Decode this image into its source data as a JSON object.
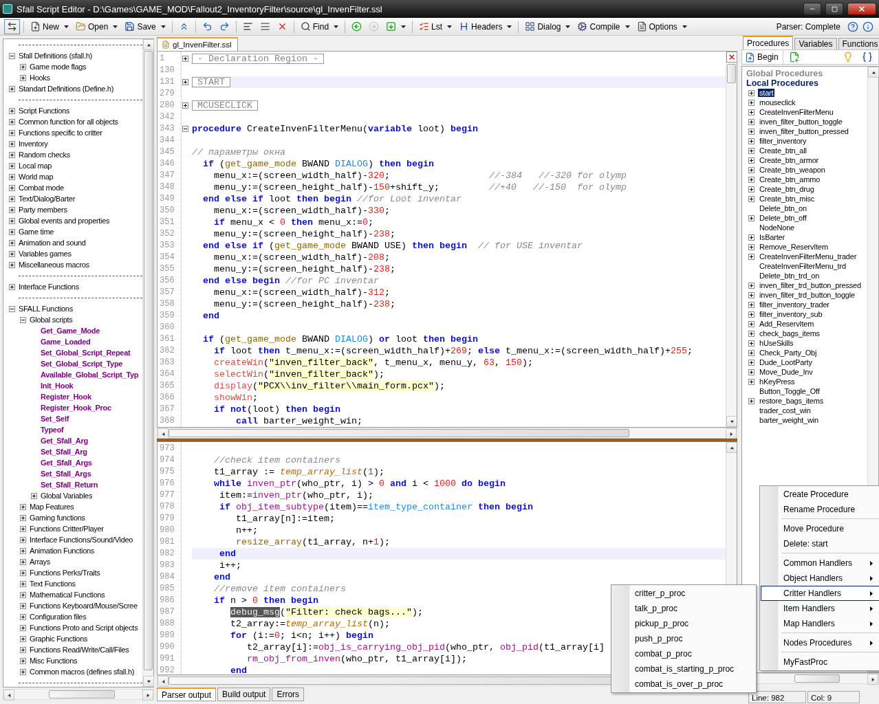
{
  "window": {
    "title": "Sfall Script Editor - D:\\Games\\GAME_MOD\\Fallout2_InventoryFilter\\source\\gl_InvenFilter.ssl"
  },
  "toolbar": {
    "items": [
      {
        "kind": "button",
        "dropdown": false,
        "disabled": false
      },
      {
        "kind": "separator"
      },
      {
        "kind": "button",
        "label": "New",
        "dropdown": true,
        "disabled": false
      },
      {
        "kind": "button",
        "label": "Open",
        "dropdown": true,
        "disabled": false
      },
      {
        "kind": "button",
        "label": "Save",
        "dropdown": true,
        "disabled": false
      },
      {
        "kind": "separator"
      },
      {
        "kind": "button",
        "dropdown": false,
        "disabled": false
      },
      {
        "kind": "separator"
      },
      {
        "kind": "button",
        "dropdown": false,
        "disabled": false
      },
      {
        "kind": "button",
        "dropdown": false,
        "disabled": false
      },
      {
        "kind": "separator"
      },
      {
        "kind": "button",
        "dropdown": false,
        "disabled": false
      },
      {
        "kind": "button",
        "dropdown": false,
        "disabled": false
      },
      {
        "kind": "button",
        "dropdown": false,
        "disabled": false
      },
      {
        "kind": "separator"
      },
      {
        "kind": "button",
        "label": "Find",
        "dropdown": true,
        "disabled": false
      },
      {
        "kind": "separator"
      },
      {
        "kind": "button",
        "dropdown": false,
        "disabled": false
      },
      {
        "kind": "button",
        "dropdown": false,
        "disabled": true
      },
      {
        "kind": "button",
        "dropdown": true,
        "disabled": false
      },
      {
        "kind": "separator"
      },
      {
        "kind": "button",
        "label": "Lst",
        "dropdown": true,
        "disabled": false
      },
      {
        "kind": "button",
        "label": "Headers",
        "dropdown": true,
        "disabled": false
      },
      {
        "kind": "separator"
      },
      {
        "kind": "button",
        "label": "Dialog",
        "dropdown": true,
        "disabled": false
      },
      {
        "kind": "button",
        "label": "Compile",
        "dropdown": true,
        "disabled": false
      },
      {
        "kind": "button",
        "label": "Options",
        "dropdown": true,
        "disabled": false
      }
    ],
    "status": "Parser: Complete"
  },
  "left_tree": {
    "nodes": [
      {
        "kind": "separator"
      },
      {
        "kind": "folder",
        "label": "Sfall Definitions (sfall.h)",
        "expanded": true,
        "children": [
          {
            "kind": "folder",
            "label": "Game mode flags",
            "expanded": false
          },
          {
            "kind": "folder",
            "label": "Hooks",
            "expanded": false
          }
        ]
      },
      {
        "kind": "folder",
        "label": "Standart Definitions (Define.h)",
        "expanded": false
      },
      {
        "kind": "separator"
      },
      {
        "kind": "folder",
        "label": "Script Functions",
        "expanded": false
      },
      {
        "kind": "folder",
        "label": "Common function for all objects",
        "expanded": false
      },
      {
        "kind": "folder",
        "label": "Functions specific to critter",
        "expanded": false
      },
      {
        "kind": "folder",
        "label": "Inventory",
        "expanded": false
      },
      {
        "kind": "folder",
        "label": "Random checks",
        "expanded": false
      },
      {
        "kind": "folder",
        "label": "Local map",
        "expanded": false
      },
      {
        "kind": "folder",
        "label": "World map",
        "expanded": false
      },
      {
        "kind": "folder",
        "label": "Combat mode",
        "expanded": false
      },
      {
        "kind": "folder",
        "label": "Text/Dialog/Barter",
        "expanded": false
      },
      {
        "kind": "folder",
        "label": "Party members",
        "expanded": false
      },
      {
        "kind": "folder",
        "label": "Global events and properties",
        "expanded": false
      },
      {
        "kind": "folder",
        "label": "Game time",
        "expanded": false
      },
      {
        "kind": "folder",
        "label": "Animation and sound",
        "expanded": false
      },
      {
        "kind": "folder",
        "label": "Variables games",
        "expanded": false
      },
      {
        "kind": "folder",
        "label": "Miscellaneous macros",
        "expanded": false
      },
      {
        "kind": "separator"
      },
      {
        "kind": "folder",
        "label": "Interface Functions",
        "expanded": false
      },
      {
        "kind": "separator"
      },
      {
        "kind": "folder",
        "label": "SFALL Functions",
        "expanded": true,
        "children": [
          {
            "kind": "folder",
            "label": "Global scripts",
            "expanded": true,
            "children": [
              {
                "kind": "function",
                "label": "Get_Game_Mode"
              },
              {
                "kind": "function",
                "label": "Game_Loaded"
              },
              {
                "kind": "function",
                "label": "Set_Global_Script_Repeat"
              },
              {
                "kind": "function",
                "label": "Set_Global_Script_Type"
              },
              {
                "kind": "function",
                "label": "Available_Global_Script_Typ"
              },
              {
                "kind": "function",
                "label": "Init_Hook"
              },
              {
                "kind": "function",
                "label": "Register_Hook"
              },
              {
                "kind": "function",
                "label": "Register_Hook_Proc"
              },
              {
                "kind": "function",
                "label": "Set_Self"
              },
              {
                "kind": "function",
                "label": "Typeof"
              },
              {
                "kind": "function",
                "label": "Get_Sfall_Arg"
              },
              {
                "kind": "function",
                "label": "Set_Sfall_Arg"
              },
              {
                "kind": "function",
                "label": "Get_Sfall_Args"
              },
              {
                "kind": "function",
                "label": "Set_Sfall_Args"
              },
              {
                "kind": "function",
                "label": "Set_Sfall_Return"
              },
              {
                "kind": "folder",
                "label": "Global Variables",
                "expanded": false
              }
            ]
          },
          {
            "kind": "folder",
            "label": "Map Features",
            "expanded": false
          },
          {
            "kind": "folder",
            "label": "Gaming functions",
            "expanded": false
          },
          {
            "kind": "folder",
            "label": "Functions Critter/Player",
            "expanded": false
          },
          {
            "kind": "folder",
            "label": "Interface Functions/Sound/Video",
            "expanded": false
          },
          {
            "kind": "folder",
            "label": "Animation Functions",
            "expanded": false
          },
          {
            "kind": "folder",
            "label": "Arrays",
            "expanded": false
          },
          {
            "kind": "folder",
            "label": "Functions Perks/Traits",
            "expanded": false
          },
          {
            "kind": "folder",
            "label": "Text Functions",
            "expanded": false
          },
          {
            "kind": "folder",
            "label": "Mathematical Functions",
            "expanded": false
          },
          {
            "kind": "folder",
            "label": "Functions Keyboard/Mouse/Scree",
            "expanded": false
          },
          {
            "kind": "folder",
            "label": "Configuration files",
            "expanded": false
          },
          {
            "kind": "folder",
            "label": "Functions Proto and Script objects",
            "expanded": false
          },
          {
            "kind": "folder",
            "label": "Graphic Functions",
            "expanded": false
          },
          {
            "kind": "folder",
            "label": "Functions Read/Write/Call/Files",
            "expanded": false
          },
          {
            "kind": "folder",
            "label": "Misc Functions",
            "expanded": false
          },
          {
            "kind": "folder",
            "label": "Common macros (defines sfall.h)",
            "expanded": false
          }
        ]
      },
      {
        "kind": "separator"
      }
    ]
  },
  "file_tab": {
    "label": "gl_InvenFilter.ssl",
    "selected": true
  },
  "top_editor": {
    "lines": [
      {
        "n": "1",
        "kind": "region",
        "label": "- Declaration Region -",
        "expanded": false,
        "current": false
      },
      {
        "n": "130",
        "current": false
      },
      {
        "n": "131",
        "kind": "region",
        "label": "START",
        "expanded": false,
        "current": true
      },
      {
        "n": "279",
        "current": false
      },
      {
        "n": "280",
        "kind": "region",
        "label": "MCUSECLICK",
        "expanded": false,
        "current": false
      },
      {
        "n": "342",
        "current": false
      },
      {
        "n": "343",
        "kind": "code",
        "expanded": true,
        "current": false,
        "tokens": [
          {
            "text": "procedure",
            "kind": "kw"
          },
          {
            "text": " CreateInvenFilterMenu(",
            "kind": "p"
          },
          {
            "text": "variable",
            "kind": "kw"
          },
          {
            "text": " loot) ",
            "kind": "p"
          },
          {
            "text": "begin",
            "kind": "kw"
          }
        ]
      },
      {
        "n": "344",
        "current": false
      },
      {
        "n": "345",
        "kind": "code",
        "current": false,
        "tokens": [
          {
            "text": "// параметры окна",
            "kind": "cmt"
          }
        ]
      },
      {
        "n": "346",
        "kind": "code",
        "current": false,
        "tokens": [
          {
            "text": "  if",
            "kind": "kw"
          },
          {
            "text": " (",
            "kind": "p"
          },
          {
            "text": "get_game_mode",
            "kind": "fn"
          },
          {
            "text": " BWAND ",
            "kind": "p"
          },
          {
            "text": "DIALOG",
            "kind": "const"
          },
          {
            "text": ") ",
            "kind": "p"
          },
          {
            "text": "then begin",
            "kind": "kw"
          }
        ]
      },
      {
        "n": "347",
        "kind": "code",
        "current": false,
        "tokens": [
          {
            "text": "    menu_x:=(screen_width_half)-",
            "kind": "p"
          },
          {
            "text": "320",
            "kind": "num"
          },
          {
            "text": ";                  ",
            "kind": "p"
          },
          {
            "text": "//-384   //-320 for olymp",
            "kind": "cmt"
          }
        ]
      },
      {
        "n": "348",
        "kind": "code",
        "current": false,
        "tokens": [
          {
            "text": "    menu_y:=(screen_height_half)-",
            "kind": "p"
          },
          {
            "text": "150",
            "kind": "num"
          },
          {
            "text": "+shift_y;         ",
            "kind": "p"
          },
          {
            "text": "//+40   //-150  for olymp",
            "kind": "cmt"
          }
        ]
      },
      {
        "n": "349",
        "kind": "code",
        "current": false,
        "tokens": [
          {
            "text": "  end else if",
            "kind": "kw"
          },
          {
            "text": " loot ",
            "kind": "p"
          },
          {
            "text": "then begin",
            "kind": "kw"
          },
          {
            "text": " //for Loot inventar",
            "kind": "cmt"
          }
        ]
      },
      {
        "n": "350",
        "kind": "code",
        "current": false,
        "tokens": [
          {
            "text": "    menu_x:=(screen_width_half)-",
            "kind": "p"
          },
          {
            "text": "330",
            "kind": "num"
          },
          {
            "text": ";",
            "kind": "p"
          }
        ]
      },
      {
        "n": "351",
        "kind": "code",
        "current": false,
        "tokens": [
          {
            "text": "    if",
            "kind": "kw"
          },
          {
            "text": " menu_x < ",
            "kind": "p"
          },
          {
            "text": "0",
            "kind": "num"
          },
          {
            "text": " then",
            "kind": "kw"
          },
          {
            "text": " menu_x:=",
            "kind": "p"
          },
          {
            "text": "0",
            "kind": "num"
          },
          {
            "text": ";",
            "kind": "p"
          }
        ]
      },
      {
        "n": "352",
        "kind": "code",
        "current": false,
        "tokens": [
          {
            "text": "    menu_y:=(screen_height_half)-",
            "kind": "p"
          },
          {
            "text": "238",
            "kind": "num"
          },
          {
            "text": ";",
            "kind": "p"
          }
        ]
      },
      {
        "n": "353",
        "kind": "code",
        "current": false,
        "tokens": [
          {
            "text": "  end else if",
            "kind": "kw"
          },
          {
            "text": " (",
            "kind": "p"
          },
          {
            "text": "get_game_mode",
            "kind": "fn"
          },
          {
            "text": " BWAND USE) ",
            "kind": "p"
          },
          {
            "text": "then begin",
            "kind": "kw"
          },
          {
            "text": "  // for USE inventar",
            "kind": "cmt"
          }
        ]
      },
      {
        "n": "354",
        "kind": "code",
        "current": false,
        "tokens": [
          {
            "text": "    menu_x:=(screen_width_half)-",
            "kind": "p"
          },
          {
            "text": "208",
            "kind": "num"
          },
          {
            "text": ";",
            "kind": "p"
          }
        ]
      },
      {
        "n": "355",
        "kind": "code",
        "current": false,
        "tokens": [
          {
            "text": "    menu_y:=(screen_height_half)-",
            "kind": "p"
          },
          {
            "text": "238",
            "kind": "num"
          },
          {
            "text": ";",
            "kind": "p"
          }
        ]
      },
      {
        "n": "356",
        "kind": "code",
        "current": false,
        "tokens": [
          {
            "text": "  end else begin",
            "kind": "kw"
          },
          {
            "text": " //for PC inventar",
            "kind": "cmt"
          }
        ]
      },
      {
        "n": "357",
        "kind": "code",
        "current": false,
        "tokens": [
          {
            "text": "    menu_x:=(screen_width_half)-",
            "kind": "p"
          },
          {
            "text": "312",
            "kind": "num"
          },
          {
            "text": ";",
            "kind": "p"
          }
        ]
      },
      {
        "n": "358",
        "kind": "code",
        "current": false,
        "tokens": [
          {
            "text": "    menu_y:=(screen_height_half)-",
            "kind": "p"
          },
          {
            "text": "238",
            "kind": "num"
          },
          {
            "text": ";",
            "kind": "p"
          }
        ]
      },
      {
        "n": "359",
        "kind": "code",
        "current": false,
        "tokens": [
          {
            "text": "  end",
            "kind": "kw"
          }
        ]
      },
      {
        "n": "360",
        "current": false
      },
      {
        "n": "361",
        "kind": "code",
        "current": false,
        "tokens": [
          {
            "text": "  if",
            "kind": "kw"
          },
          {
            "text": " (",
            "kind": "p"
          },
          {
            "text": "get_game_mode",
            "kind": "fn"
          },
          {
            "text": " BWAND ",
            "kind": "p"
          },
          {
            "text": "DIALOG",
            "kind": "const"
          },
          {
            "text": ") ",
            "kind": "p"
          },
          {
            "text": "or",
            "kind": "kw"
          },
          {
            "text": " loot ",
            "kind": "p"
          },
          {
            "text": "then begin",
            "kind": "kw"
          }
        ]
      },
      {
        "n": "362",
        "kind": "code",
        "current": false,
        "tokens": [
          {
            "text": "    if",
            "kind": "kw"
          },
          {
            "text": " loot ",
            "kind": "p"
          },
          {
            "text": "then",
            "kind": "kw"
          },
          {
            "text": " t_menu_x:=(screen_width_half)+",
            "kind": "p"
          },
          {
            "text": "269",
            "kind": "num"
          },
          {
            "text": "; ",
            "kind": "p"
          },
          {
            "text": "else",
            "kind": "kw"
          },
          {
            "text": " t_menu_x:=(screen_width_half)+",
            "kind": "p"
          },
          {
            "text": "255",
            "kind": "num"
          },
          {
            "text": ";",
            "kind": "p"
          }
        ]
      },
      {
        "n": "363",
        "kind": "code",
        "current": false,
        "tokens": [
          {
            "text": "    createWin",
            "kind": "lib"
          },
          {
            "text": "(",
            "kind": "p"
          },
          {
            "text": "\"inven_filter_back\"",
            "kind": "str"
          },
          {
            "text": ", t_menu_x, menu_y, ",
            "kind": "p"
          },
          {
            "text": "63",
            "kind": "num"
          },
          {
            "text": ", ",
            "kind": "p"
          },
          {
            "text": "150",
            "kind": "num"
          },
          {
            "text": ");",
            "kind": "p"
          }
        ]
      },
      {
        "n": "364",
        "kind": "code",
        "current": false,
        "tokens": [
          {
            "text": "    selectWin",
            "kind": "lib"
          },
          {
            "text": "(",
            "kind": "p"
          },
          {
            "text": "\"inven_filter_back\"",
            "kind": "str"
          },
          {
            "text": ");",
            "kind": "p"
          }
        ]
      },
      {
        "n": "365",
        "kind": "code",
        "current": false,
        "tokens": [
          {
            "text": "    display",
            "kind": "lib"
          },
          {
            "text": "(",
            "kind": "p"
          },
          {
            "text": "\"PCX\\\\inv_filter\\\\main_form.pcx\"",
            "kind": "str"
          },
          {
            "text": ");",
            "kind": "p"
          }
        ]
      },
      {
        "n": "366",
        "kind": "code",
        "current": false,
        "tokens": [
          {
            "text": "    showWin",
            "kind": "lib"
          },
          {
            "text": ";",
            "kind": "p"
          }
        ]
      },
      {
        "n": "367",
        "kind": "code",
        "current": false,
        "tokens": [
          {
            "text": "    if not",
            "kind": "kw"
          },
          {
            "text": "(loot) ",
            "kind": "p"
          },
          {
            "text": "then begin",
            "kind": "kw"
          }
        ]
      },
      {
        "n": "368",
        "kind": "code",
        "current": false,
        "tokens": [
          {
            "text": "        call",
            "kind": "kw"
          },
          {
            "text": " barter_weight_win;",
            "kind": "p"
          }
        ]
      }
    ]
  },
  "bottom_editor": {
    "lines": [
      {
        "n": "973",
        "current": false
      },
      {
        "n": "974",
        "kind": "code",
        "current": false,
        "tokens": [
          {
            "text": "    //check item containers",
            "kind": "cmt"
          }
        ]
      },
      {
        "n": "975",
        "kind": "code",
        "current": false,
        "tokens": [
          {
            "text": "    t1_array := ",
            "kind": "p"
          },
          {
            "text": "temp_array_list",
            "kind": "tmp"
          },
          {
            "text": "(",
            "kind": "p"
          },
          {
            "text": "1",
            "kind": "num"
          },
          {
            "text": ");",
            "kind": "p"
          }
        ]
      },
      {
        "n": "976",
        "kind": "code",
        "current": false,
        "tokens": [
          {
            "text": "    while",
            "kind": "kw"
          },
          {
            "text": " inven_ptr",
            "kind": "proc"
          },
          {
            "text": "(who_ptr, i) > ",
            "kind": "p"
          },
          {
            "text": "0",
            "kind": "num"
          },
          {
            "text": " and",
            "kind": "kw"
          },
          {
            "text": " i < ",
            "kind": "p"
          },
          {
            "text": "1000",
            "kind": "num"
          },
          {
            "text": " do begin",
            "kind": "kw"
          }
        ]
      },
      {
        "n": "977",
        "kind": "code",
        "current": false,
        "tokens": [
          {
            "text": "     item:=",
            "kind": "p"
          },
          {
            "text": "inven_ptr",
            "kind": "proc"
          },
          {
            "text": "(who_ptr, i);",
            "kind": "p"
          }
        ]
      },
      {
        "n": "978",
        "kind": "code",
        "current": false,
        "tokens": [
          {
            "text": "     if",
            "kind": "kw"
          },
          {
            "text": " obj_item_subtype",
            "kind": "proc"
          },
          {
            "text": "(item)==",
            "kind": "p"
          },
          {
            "text": "item_type_container",
            "kind": "const"
          },
          {
            "text": " then begin",
            "kind": "kw"
          }
        ]
      },
      {
        "n": "979",
        "kind": "code",
        "current": false,
        "tokens": [
          {
            "text": "        t1_array[n]:=item;",
            "kind": "p"
          }
        ]
      },
      {
        "n": "980",
        "kind": "code",
        "current": false,
        "tokens": [
          {
            "text": "        n++;",
            "kind": "p"
          }
        ]
      },
      {
        "n": "981",
        "kind": "code",
        "current": false,
        "tokens": [
          {
            "text": "        resize_array",
            "kind": "fn"
          },
          {
            "text": "(t1_array, n+",
            "kind": "p"
          },
          {
            "text": "1",
            "kind": "num"
          },
          {
            "text": ");",
            "kind": "p"
          }
        ]
      },
      {
        "n": "982",
        "kind": "code",
        "current": true,
        "tokens": [
          {
            "text": "     end",
            "kind": "kw"
          }
        ]
      },
      {
        "n": "983",
        "kind": "code",
        "current": false,
        "tokens": [
          {
            "text": "     i++;",
            "kind": "p"
          }
        ]
      },
      {
        "n": "984",
        "kind": "code",
        "current": false,
        "tokens": [
          {
            "text": "    end",
            "kind": "kw"
          }
        ]
      },
      {
        "n": "985",
        "kind": "code",
        "current": false,
        "tokens": [
          {
            "text": "    //remove item containers",
            "kind": "cmt"
          }
        ]
      },
      {
        "n": "986",
        "kind": "code",
        "current": false,
        "tokens": [
          {
            "text": "    if",
            "kind": "kw"
          },
          {
            "text": " n > ",
            "kind": "p"
          },
          {
            "text": "0",
            "kind": "num"
          },
          {
            "text": " then begin",
            "kind": "kw"
          }
        ]
      },
      {
        "n": "987",
        "kind": "code",
        "current": false,
        "tokens": [
          {
            "text": "       debug_msg",
            "kind": "sel"
          },
          {
            "text": "(",
            "kind": "p"
          },
          {
            "text": "\"Filter: check bags...\"",
            "kind": "str"
          },
          {
            "text": ");",
            "kind": "p"
          }
        ]
      },
      {
        "n": "988",
        "kind": "code",
        "current": false,
        "tokens": [
          {
            "text": "       t2_array:=",
            "kind": "p"
          },
          {
            "text": "temp_array_list",
            "kind": "tmp"
          },
          {
            "text": "(n);",
            "kind": "p"
          }
        ]
      },
      {
        "n": "989",
        "kind": "code",
        "current": false,
        "tokens": [
          {
            "text": "       for",
            "kind": "kw"
          },
          {
            "text": " (i:=",
            "kind": "p"
          },
          {
            "text": "0",
            "kind": "num"
          },
          {
            "text": "; i<n; i++) ",
            "kind": "p"
          },
          {
            "text": "begin",
            "kind": "kw"
          }
        ]
      },
      {
        "n": "990",
        "kind": "code",
        "current": false,
        "tokens": [
          {
            "text": "          t2_array[i]:=",
            "kind": "p"
          },
          {
            "text": "obj_is_carrying_obj_pid",
            "kind": "proc"
          },
          {
            "text": "(who_ptr, ",
            "kind": "p"
          },
          {
            "text": "obj_pid",
            "kind": "proc"
          },
          {
            "text": "(t1_array[i]",
            "kind": "p"
          }
        ]
      },
      {
        "n": "991",
        "kind": "code",
        "current": false,
        "tokens": [
          {
            "text": "          rm_obj_from_inven",
            "kind": "proc"
          },
          {
            "text": "(who_ptr, t1_array[i]);",
            "kind": "p"
          }
        ]
      },
      {
        "n": "992",
        "kind": "code",
        "current": false,
        "tokens": [
          {
            "text": "       end",
            "kind": "kw"
          }
        ]
      }
    ]
  },
  "bottom_tabs": [
    {
      "label": "Parser output",
      "selected": true
    },
    {
      "label": "Build output",
      "selected": false
    },
    {
      "label": "Errors",
      "selected": false
    }
  ],
  "right_panel": {
    "tabs": [
      {
        "label": "Procedures",
        "selected": true
      },
      {
        "label": "Variables",
        "selected": false
      },
      {
        "label": "Functions",
        "selected": false
      }
    ],
    "begin_button": "Begin",
    "headers": [
      {
        "label": "Global Procedures",
        "kind": "global"
      },
      {
        "label": "Local Procedures",
        "kind": "local"
      }
    ],
    "items": [
      {
        "label": "start",
        "expandable": true,
        "selected": true
      },
      {
        "label": "mouseclick",
        "expandable": true,
        "selected": false
      },
      {
        "label": "CreateInvenFilterMenu",
        "expandable": true,
        "selected": false
      },
      {
        "label": "inven_filter_button_toggle",
        "expandable": true,
        "selected": false
      },
      {
        "label": "inven_filter_button_pressed",
        "expandable": true,
        "selected": false
      },
      {
        "label": "filter_inventory",
        "expandable": true,
        "selected": false
      },
      {
        "label": "Create_btn_all",
        "expandable": true,
        "selected": false
      },
      {
        "label": "Create_btn_armor",
        "expandable": true,
        "selected": false
      },
      {
        "label": "Create_btn_weapon",
        "expandable": true,
        "selected": false
      },
      {
        "label": "Create_btn_ammo",
        "expandable": true,
        "selected": false
      },
      {
        "label": "Create_btn_drug",
        "expandable": true,
        "selected": false
      },
      {
        "label": "Create_btn_misc",
        "expandable": true,
        "selected": false
      },
      {
        "label": "Delete_btn_on",
        "expandable": false,
        "selected": false
      },
      {
        "label": "Delete_btn_off",
        "expandable": true,
        "selected": false
      },
      {
        "label": "NodeNone",
        "expandable": false,
        "selected": false
      },
      {
        "label": "IsBarter",
        "expandable": true,
        "selected": false
      },
      {
        "label": "Remove_ReservItem",
        "expandable": true,
        "selected": false
      },
      {
        "label": "CreateInvenFilterMenu_trader",
        "expandable": true,
        "selected": false
      },
      {
        "label": "CreateInvenFilterMenu_trd",
        "expandable": false,
        "selected": false
      },
      {
        "label": "Delete_btn_trd_on",
        "expandable": false,
        "selected": false
      },
      {
        "label": "inven_filter_trd_button_pressed",
        "expandable": true,
        "selected": false
      },
      {
        "label": "inven_filter_trd_button_toggle",
        "expandable": true,
        "selected": false
      },
      {
        "label": "filter_inventory_trader",
        "expandable": true,
        "selected": false
      },
      {
        "label": "filter_inventory_sub",
        "expandable": true,
        "selected": false
      },
      {
        "label": "Add_ReservItem",
        "expandable": true,
        "selected": false
      },
      {
        "label": "check_bags_items",
        "expandable": true,
        "selected": false
      },
      {
        "label": "hUseSkills",
        "expandable": true,
        "selected": false
      },
      {
        "label": "Check_Party_Obj",
        "expandable": true,
        "selected": false
      },
      {
        "label": "Dude_LootParty",
        "expandable": true,
        "selected": false
      },
      {
        "label": "Move_Dude_Inv",
        "expandable": true,
        "selected": false
      },
      {
        "label": "hKeyPress",
        "expandable": true,
        "selected": false
      },
      {
        "label": "Button_Toggle_Off",
        "expandable": false,
        "selected": false
      },
      {
        "label": "restore_bags_items",
        "expandable": true,
        "selected": false
      },
      {
        "label": "trader_cost_win",
        "expandable": false,
        "selected": false
      },
      {
        "label": "barter_weight_win",
        "expandable": false,
        "selected": false
      }
    ]
  },
  "status_bar": {
    "line": "Line: 982",
    "col": "Col: 9"
  },
  "context_menu": {
    "items": [
      {
        "kind": "item",
        "label": "Create Procedure",
        "selected": false
      },
      {
        "kind": "item",
        "label": "Rename Procedure",
        "selected": false
      },
      {
        "kind": "separator"
      },
      {
        "kind": "item",
        "label": "Move Procedure",
        "selected": false
      },
      {
        "kind": "item",
        "label": "Delete: start",
        "selected": false
      },
      {
        "kind": "separator"
      },
      {
        "kind": "submenu",
        "label": "Common Handlers",
        "selected": false
      },
      {
        "kind": "submenu",
        "label": "Object Handlers",
        "selected": false
      },
      {
        "kind": "submenu",
        "label": "Critter Handlers",
        "selected": true
      },
      {
        "kind": "submenu",
        "label": "Item Handlers",
        "selected": false
      },
      {
        "kind": "submenu",
        "label": "Map Handlers",
        "selected": false
      },
      {
        "kind": "separator"
      },
      {
        "kind": "submenu",
        "label": "Nodes Procedures",
        "selected": false
      },
      {
        "kind": "separator"
      },
      {
        "kind": "item",
        "label": "MyFastProc",
        "selected": false
      }
    ]
  },
  "submenu": {
    "items": [
      {
        "kind": "item",
        "label": "critter_p_proc",
        "selected": false
      },
      {
        "kind": "item",
        "label": "talk_p_proc",
        "selected": false
      },
      {
        "kind": "item",
        "label": "pickup_p_proc",
        "selected": false
      },
      {
        "kind": "item",
        "label": "push_p_proc",
        "selected": false
      },
      {
        "kind": "item",
        "label": "combat_p_proc",
        "selected": false
      },
      {
        "kind": "item",
        "label": "combat_is_starting_p_proc",
        "selected": false
      },
      {
        "kind": "item",
        "label": "combat_is_over_p_proc",
        "selected": false
      }
    ]
  }
}
